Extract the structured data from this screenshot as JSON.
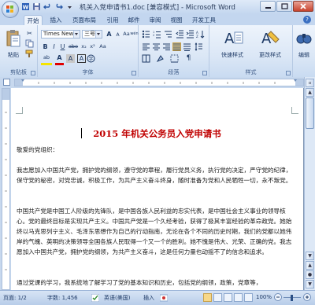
{
  "window": {
    "title": "机关入党申请书1.doc [兼容模式] - Microsoft Word"
  },
  "quick_access": {
    "icons": [
      "word-doc-icon",
      "save-icon",
      "undo-icon",
      "redo-icon",
      "customize-icon"
    ]
  },
  "tabs": [
    {
      "label": "开始",
      "active": true
    },
    {
      "label": "插入"
    },
    {
      "label": "页面布局"
    },
    {
      "label": "引用"
    },
    {
      "label": "邮件"
    },
    {
      "label": "审阅"
    },
    {
      "label": "视图"
    },
    {
      "label": "开发工具"
    }
  ],
  "ribbon": {
    "clipboard": {
      "paste_label": "粘贴",
      "group_label": "剪贴板"
    },
    "font": {
      "font_name": "Times New F",
      "font_size": "三号",
      "bold": "B",
      "italic": "I",
      "underline": "U",
      "strike": "abe",
      "subscript": "x₂",
      "superscript": "x²",
      "font_color": "A",
      "highlight": "ab",
      "size_up": "A",
      "size_down": "A",
      "clear_format": "Aa",
      "phonetic": "wén",
      "char_border": "A",
      "group_label": "字体"
    },
    "paragraph": {
      "group_label": "段落"
    },
    "styles": {
      "quick_styles_label": "快速样式",
      "change_styles_label": "更改样式",
      "group_label": "样式"
    },
    "editing": {
      "label": "编辑"
    }
  },
  "document": {
    "title": "2015 年机关公务员入党申请书",
    "salutation": "敬爱的党组织：",
    "paragraphs": [
      "我志愿加入中国共产党，拥护党的纲领，遵守党的章程，履行党员义务，执行党的决定，严守党的纪律，保守党的秘密，对党忠诚，积极工作，为共产主义奋斗终身，随时准备为党和人民牺牲一切，永不叛党。",
      "中国共产党是中国工人阶级的先锋队，是中国各族人民利益的忠实代表，是中国社会主义事业的领导核心。党的最终目标是实现共产主义。中国共产党是一个久经考验，获得了极其丰富经验的革命政党。她始终以马克思列宁主义、毛泽东思想作为自己的行动指南，无论在各个不同的历史时期，我们的党都以她伟岸的气魄、英明的决策领导全国各族人民取得一个又一个的胜利。她不愧是伟大、光荣、正确的党。我志愿加入中国共产党，拥护党的纲领，为共产主义奋斗，这是任何力量也动摇不了的信念和追求。",
      "通过党课的学习，我系统地了解学习了党的基本知识和历史，包括党的纲领，政策，党章等，"
    ]
  },
  "status": {
    "page": "页面: 1/2",
    "words": "字数: 1,456",
    "language": "英语(美国)",
    "mode": "插入",
    "zoom": "100%"
  }
}
